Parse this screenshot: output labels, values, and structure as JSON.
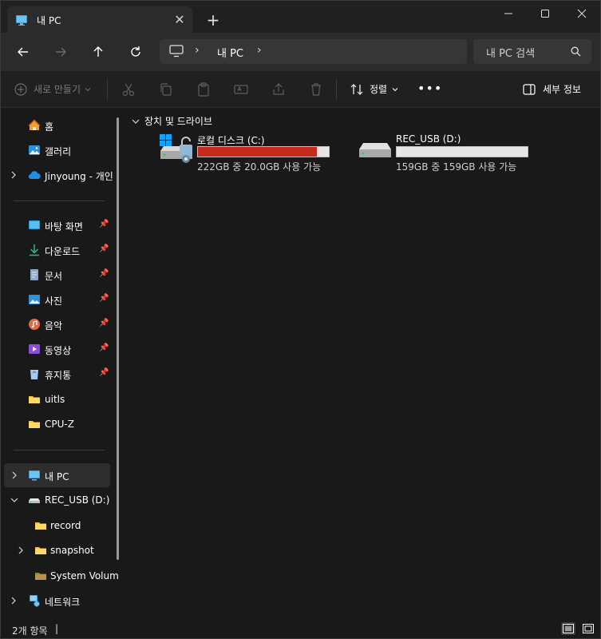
{
  "window": {
    "tab_title": "내 PC",
    "tab_close": "✕",
    "new_tab": "+"
  },
  "address_bar": {
    "sep": "›",
    "path": "내 PC",
    "sep2": "›",
    "search_placeholder": "내 PC 검색"
  },
  "command_bar": {
    "new_label": "새로 만들기",
    "sort_label": "정렬",
    "more_label": "•••",
    "details_label": "세부 정보"
  },
  "sidebar": {
    "home": "홈",
    "gallery": "갤러리",
    "onedrive": "Jinyoung - 개인",
    "desktop": "바탕 화면",
    "downloads": "다운로드",
    "documents": "문서",
    "pictures": "사진",
    "music": "음악",
    "videos": "동영상",
    "recycle": "휴지통",
    "uitls": "uitls",
    "cpuz": "CPU-Z",
    "this_pc": "내 PC",
    "rec_usb": "REC_USB (D:)",
    "record": "record",
    "snapshot": "snapshot",
    "system_volume": "System Volum",
    "network": "네트워크"
  },
  "main": {
    "group_header": "장치 및 드라이브",
    "drives": [
      {
        "name": "로컬 디스크 (C:)",
        "info": "222GB 중 20.0GB 사용 가능",
        "used_fraction": 0.91,
        "bar_color": "#c42b1c"
      },
      {
        "name": "REC_USB (D:)",
        "info": "159GB 중 159GB 사용 가능",
        "used_fraction": 0.0,
        "bar_color": "#26a0da"
      }
    ]
  },
  "status_bar": {
    "item_count": "2개 항목",
    "separator": "|"
  }
}
